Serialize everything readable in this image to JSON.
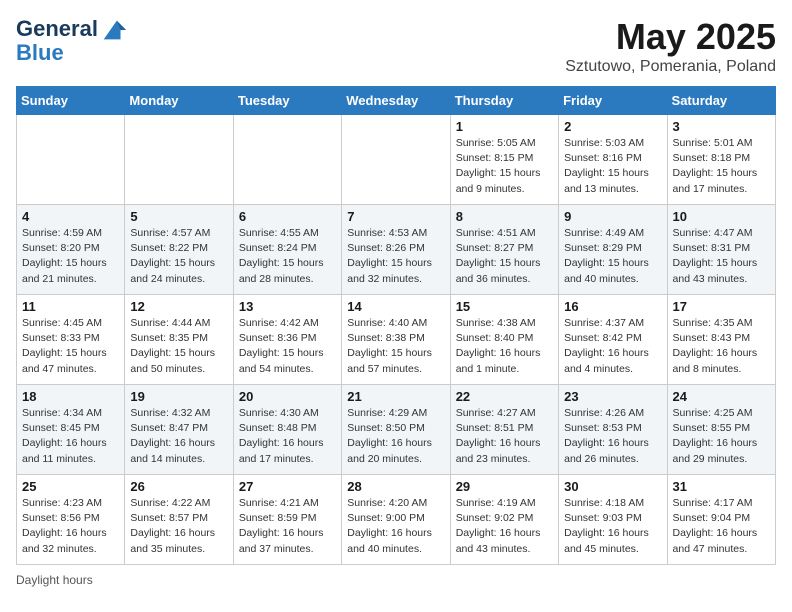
{
  "header": {
    "logo_line1": "General",
    "logo_line2": "Blue",
    "month": "May 2025",
    "location": "Sztutowo, Pomerania, Poland"
  },
  "weekdays": [
    "Sunday",
    "Monday",
    "Tuesday",
    "Wednesday",
    "Thursday",
    "Friday",
    "Saturday"
  ],
  "weeks": [
    [
      {
        "day": "",
        "info": ""
      },
      {
        "day": "",
        "info": ""
      },
      {
        "day": "",
        "info": ""
      },
      {
        "day": "",
        "info": ""
      },
      {
        "day": "1",
        "info": "Sunrise: 5:05 AM\nSunset: 8:15 PM\nDaylight: 15 hours\nand 9 minutes."
      },
      {
        "day": "2",
        "info": "Sunrise: 5:03 AM\nSunset: 8:16 PM\nDaylight: 15 hours\nand 13 minutes."
      },
      {
        "day": "3",
        "info": "Sunrise: 5:01 AM\nSunset: 8:18 PM\nDaylight: 15 hours\nand 17 minutes."
      }
    ],
    [
      {
        "day": "4",
        "info": "Sunrise: 4:59 AM\nSunset: 8:20 PM\nDaylight: 15 hours\nand 21 minutes."
      },
      {
        "day": "5",
        "info": "Sunrise: 4:57 AM\nSunset: 8:22 PM\nDaylight: 15 hours\nand 24 minutes."
      },
      {
        "day": "6",
        "info": "Sunrise: 4:55 AM\nSunset: 8:24 PM\nDaylight: 15 hours\nand 28 minutes."
      },
      {
        "day": "7",
        "info": "Sunrise: 4:53 AM\nSunset: 8:26 PM\nDaylight: 15 hours\nand 32 minutes."
      },
      {
        "day": "8",
        "info": "Sunrise: 4:51 AM\nSunset: 8:27 PM\nDaylight: 15 hours\nand 36 minutes."
      },
      {
        "day": "9",
        "info": "Sunrise: 4:49 AM\nSunset: 8:29 PM\nDaylight: 15 hours\nand 40 minutes."
      },
      {
        "day": "10",
        "info": "Sunrise: 4:47 AM\nSunset: 8:31 PM\nDaylight: 15 hours\nand 43 minutes."
      }
    ],
    [
      {
        "day": "11",
        "info": "Sunrise: 4:45 AM\nSunset: 8:33 PM\nDaylight: 15 hours\nand 47 minutes."
      },
      {
        "day": "12",
        "info": "Sunrise: 4:44 AM\nSunset: 8:35 PM\nDaylight: 15 hours\nand 50 minutes."
      },
      {
        "day": "13",
        "info": "Sunrise: 4:42 AM\nSunset: 8:36 PM\nDaylight: 15 hours\nand 54 minutes."
      },
      {
        "day": "14",
        "info": "Sunrise: 4:40 AM\nSunset: 8:38 PM\nDaylight: 15 hours\nand 57 minutes."
      },
      {
        "day": "15",
        "info": "Sunrise: 4:38 AM\nSunset: 8:40 PM\nDaylight: 16 hours\nand 1 minute."
      },
      {
        "day": "16",
        "info": "Sunrise: 4:37 AM\nSunset: 8:42 PM\nDaylight: 16 hours\nand 4 minutes."
      },
      {
        "day": "17",
        "info": "Sunrise: 4:35 AM\nSunset: 8:43 PM\nDaylight: 16 hours\nand 8 minutes."
      }
    ],
    [
      {
        "day": "18",
        "info": "Sunrise: 4:34 AM\nSunset: 8:45 PM\nDaylight: 16 hours\nand 11 minutes."
      },
      {
        "day": "19",
        "info": "Sunrise: 4:32 AM\nSunset: 8:47 PM\nDaylight: 16 hours\nand 14 minutes."
      },
      {
        "day": "20",
        "info": "Sunrise: 4:30 AM\nSunset: 8:48 PM\nDaylight: 16 hours\nand 17 minutes."
      },
      {
        "day": "21",
        "info": "Sunrise: 4:29 AM\nSunset: 8:50 PM\nDaylight: 16 hours\nand 20 minutes."
      },
      {
        "day": "22",
        "info": "Sunrise: 4:27 AM\nSunset: 8:51 PM\nDaylight: 16 hours\nand 23 minutes."
      },
      {
        "day": "23",
        "info": "Sunrise: 4:26 AM\nSunset: 8:53 PM\nDaylight: 16 hours\nand 26 minutes."
      },
      {
        "day": "24",
        "info": "Sunrise: 4:25 AM\nSunset: 8:55 PM\nDaylight: 16 hours\nand 29 minutes."
      }
    ],
    [
      {
        "day": "25",
        "info": "Sunrise: 4:23 AM\nSunset: 8:56 PM\nDaylight: 16 hours\nand 32 minutes."
      },
      {
        "day": "26",
        "info": "Sunrise: 4:22 AM\nSunset: 8:57 PM\nDaylight: 16 hours\nand 35 minutes."
      },
      {
        "day": "27",
        "info": "Sunrise: 4:21 AM\nSunset: 8:59 PM\nDaylight: 16 hours\nand 37 minutes."
      },
      {
        "day": "28",
        "info": "Sunrise: 4:20 AM\nSunset: 9:00 PM\nDaylight: 16 hours\nand 40 minutes."
      },
      {
        "day": "29",
        "info": "Sunrise: 4:19 AM\nSunset: 9:02 PM\nDaylight: 16 hours\nand 43 minutes."
      },
      {
        "day": "30",
        "info": "Sunrise: 4:18 AM\nSunset: 9:03 PM\nDaylight: 16 hours\nand 45 minutes."
      },
      {
        "day": "31",
        "info": "Sunrise: 4:17 AM\nSunset: 9:04 PM\nDaylight: 16 hours\nand 47 minutes."
      }
    ]
  ],
  "footer": {
    "label": "Daylight hours"
  }
}
